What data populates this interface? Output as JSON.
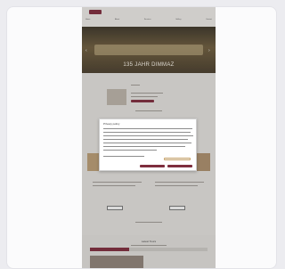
{
  "nav": {
    "links": [
      "Home",
      "About",
      "Services",
      "Gallery",
      "Contact"
    ]
  },
  "hero": {
    "title": "135 JAHR DIMMAZ"
  },
  "cookie": {
    "title": "Privacy policy"
  },
  "footer": {
    "title": "Latest Tours"
  },
  "colors": {
    "brand": "#7e2e3e",
    "background": "#ececf0",
    "hero_dark": "#3e372a"
  }
}
